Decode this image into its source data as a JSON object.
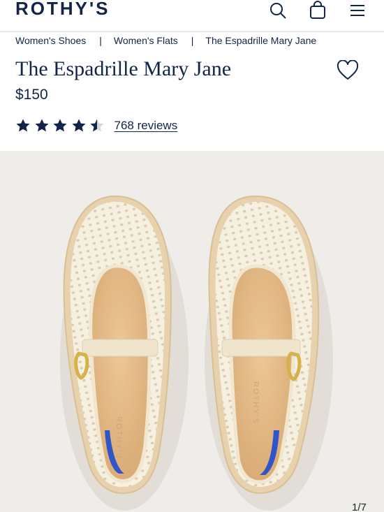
{
  "header": {
    "logo": "ROTHY'S",
    "icons": [
      "search-icon",
      "shopping-bag-icon",
      "menu-icon"
    ]
  },
  "breadcrumb": {
    "items": [
      "Women's Shoes",
      "Women's Flats",
      "The Espadrille Mary Jane"
    ],
    "separator": "|"
  },
  "product": {
    "title": "The Espadrille Mary Jane",
    "price": "$150",
    "rating_value": 4.5,
    "rating_max": 5,
    "reviews_label": "768 reviews",
    "wishlist_icon": "heart-icon"
  },
  "gallery": {
    "counter": "1/7",
    "insole_brand": "ROTHY'S"
  },
  "colors": {
    "navy": "#12244a",
    "gallery_bg": "#efedea",
    "shoe_knit": "#f4eedd",
    "insole": "#e2b98a",
    "heel_accent": "#2f55c9",
    "buckle": "#d6b24a"
  }
}
